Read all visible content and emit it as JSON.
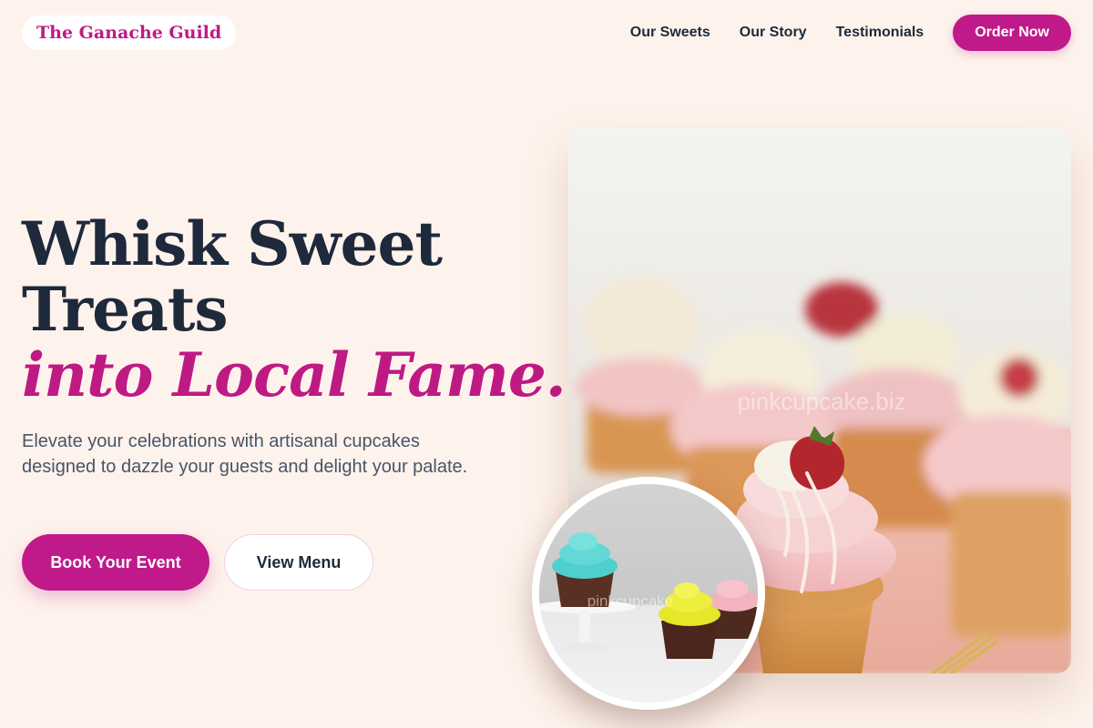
{
  "brand": {
    "name": "The Ganache Guild"
  },
  "nav": {
    "links": [
      "Our Sweets",
      "Our Story",
      "Testimonials"
    ],
    "cta": "Order Now"
  },
  "hero": {
    "title_line1": "Whisk Sweet",
    "title_line2": "Treats",
    "title_accent": "into Local Fame.",
    "subtitle": "Elevate your celebrations with artisanal cupcakes designed to dazzle your guests and delight your palate.",
    "primary_button": "Book Your Event",
    "secondary_button": "View Menu"
  },
  "images": {
    "main_watermark": "pinkcupcake.biz",
    "inset_watermark": "pinkcupcake"
  },
  "colors": {
    "background": "#fef3ec",
    "accent": "#c0198a",
    "text": "#1e293b",
    "muted": "#475569"
  }
}
